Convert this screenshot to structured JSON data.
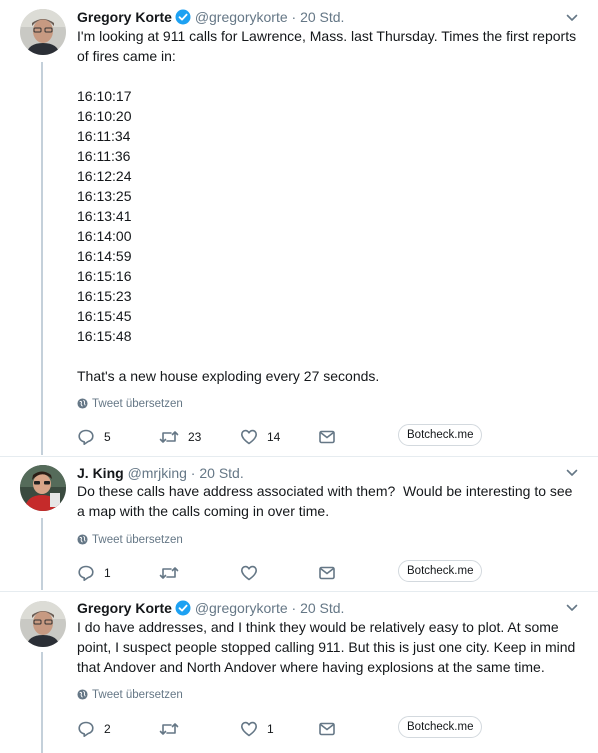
{
  "tweets": [
    {
      "name": "Gregory Korte",
      "handle": "@gregorykorte",
      "dot": "·",
      "time": "20 Std.",
      "verified": true,
      "text": "I'm looking at 911 calls for Lawrence, Mass. last Thursday. Times the first reports of fires came in:\n\n16:10:17\n16:10:20\n16:11:34\n16:11:36\n16:12:24\n16:13:25\n16:13:41\n16:14:00\n16:14:59\n16:15:16\n16:15:23\n16:15:45\n16:15:48\n\nThat's a new house exploding every 27 seconds.",
      "translate": "Tweet übersetzen",
      "replies": "5",
      "retweets": "23",
      "likes": "14",
      "botcheck": "Botcheck.me"
    },
    {
      "name": "J. King",
      "handle": "@mrjking",
      "dot": "·",
      "time": "20 Std.",
      "verified": false,
      "text": "Do these calls have address associated with them?  Would be interesting to see a map with the calls coming in over time.",
      "translate": "Tweet übersetzen",
      "replies": "1",
      "retweets": "",
      "likes": "",
      "botcheck": "Botcheck.me"
    },
    {
      "name": "Gregory Korte",
      "handle": "@gregorykorte",
      "dot": "·",
      "time": "20 Std.",
      "verified": true,
      "text": "I do have addresses, and I think they would be relatively easy to plot. At some point, I suspect people stopped calling 911. But this is just one city. Keep in mind that Andover and North Andover where having explosions at the same time.",
      "translate": "Tweet übersetzen",
      "replies": "2",
      "retweets": "",
      "likes": "1",
      "botcheck": "Botcheck.me"
    }
  ],
  "colors": {
    "verified": "#1da1f2",
    "muted": "#657786",
    "text": "#14171a",
    "thread_line": "#c4d0da"
  }
}
